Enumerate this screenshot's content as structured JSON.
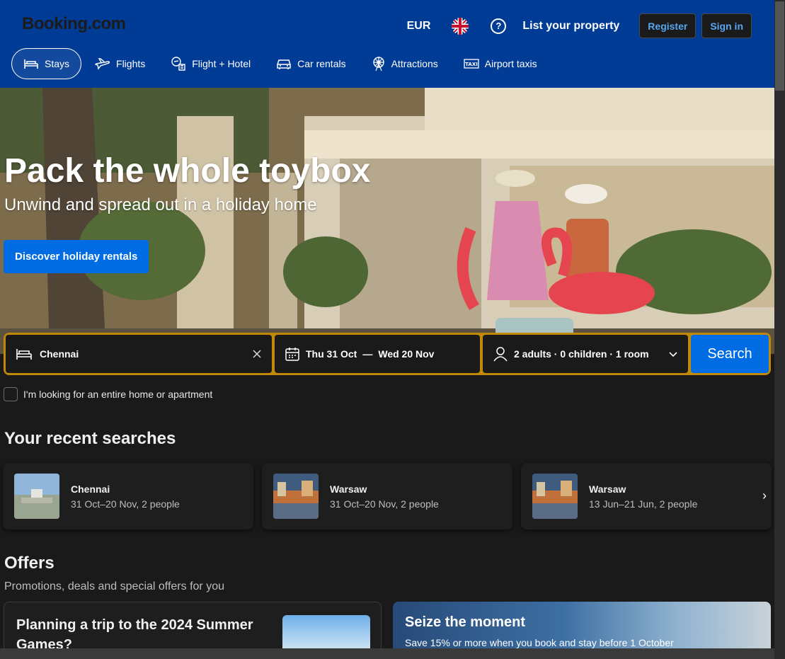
{
  "header": {
    "logo": "Booking.com",
    "currency": "EUR",
    "help_icon": "?",
    "list_property": "List your property",
    "register": "Register",
    "sign_in": "Sign in"
  },
  "nav": [
    {
      "label": "Stays",
      "icon": "bed-icon",
      "active": true
    },
    {
      "label": "Flights",
      "icon": "plane-icon"
    },
    {
      "label": "Flight + Hotel",
      "icon": "flight-hotel-icon"
    },
    {
      "label": "Car rentals",
      "icon": "car-icon"
    },
    {
      "label": "Attractions",
      "icon": "ferris-wheel-icon"
    },
    {
      "label": "Airport taxis",
      "icon": "taxi-icon"
    }
  ],
  "hero": {
    "title": "Pack the whole toybox",
    "subtitle": "Unwind and spread out in a holiday home",
    "cta": "Discover holiday rentals"
  },
  "search": {
    "destination": "Chennai",
    "checkin": "Thu 31 Oct",
    "dash": "—",
    "checkout": "Wed 20 Nov",
    "guests": "2 adults · 0 children · 1 room",
    "button": "Search",
    "entire_home_label": "I'm looking for an entire home or apartment",
    "entire_home_checked": false
  },
  "recent": {
    "title": "Your recent searches",
    "items": [
      {
        "city": "Chennai",
        "meta": "31 Oct–20 Nov, 2 people"
      },
      {
        "city": "Warsaw",
        "meta": "31 Oct–20 Nov, 2 people"
      },
      {
        "city": "Warsaw",
        "meta": "13 Jun–21 Jun, 2 people"
      }
    ],
    "next_arrow": "›"
  },
  "offers": {
    "title": "Offers",
    "subtitle": "Promotions, deals and special offers for you",
    "cards": [
      {
        "title": "Planning a trip to the 2024 Summer Games?"
      },
      {
        "title": "Seize the moment",
        "desc": "Save 15% or more when you book and stay before 1 October"
      }
    ]
  },
  "colors": {
    "brand_blue": "#003b95",
    "action_blue": "#006ce4",
    "search_border": "#c08a08",
    "bg": "#1a1a1a"
  }
}
